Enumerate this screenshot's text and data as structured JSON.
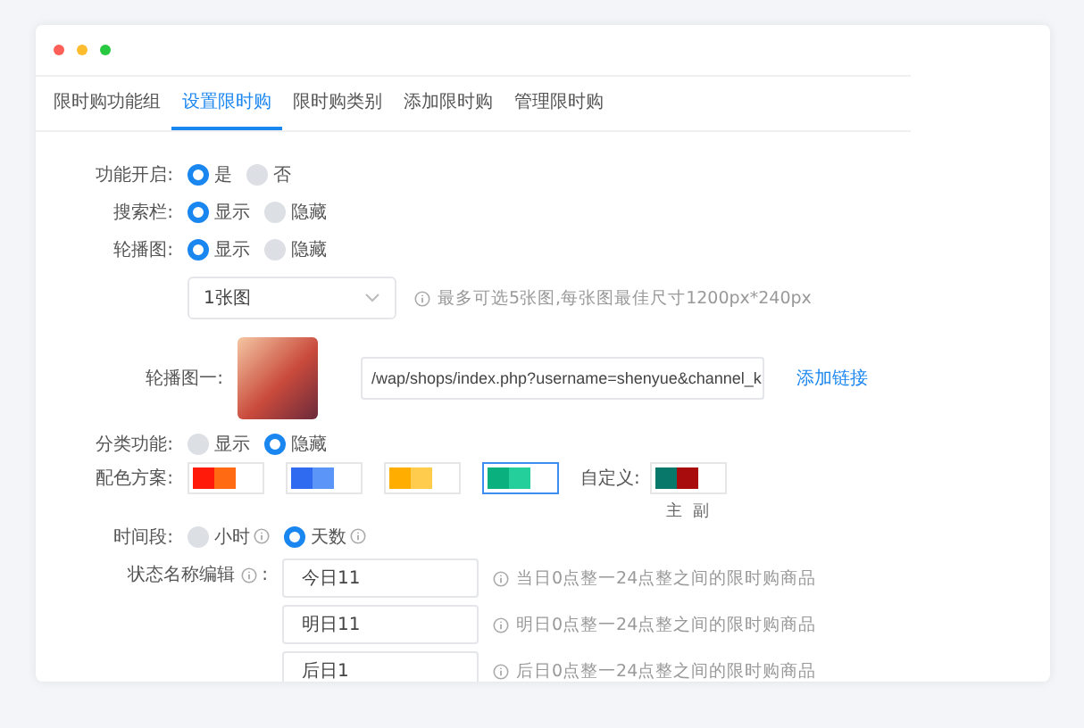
{
  "tabs": [
    {
      "label": "限时购功能组",
      "selected": false
    },
    {
      "label": "设置限时购",
      "selected": true
    },
    {
      "label": "限时购类别",
      "selected": false
    },
    {
      "label": "添加限时购",
      "selected": false
    },
    {
      "label": "管理限时购",
      "selected": false
    }
  ],
  "rows": [
    {
      "kind": "radio",
      "label": "功能开启:",
      "options": [
        {
          "label": "是",
          "selected": true,
          "info": false
        },
        {
          "label": "否",
          "selected": false,
          "info": false
        }
      ]
    },
    {
      "kind": "radio",
      "label": "搜索栏:",
      "options": [
        {
          "label": "显示",
          "selected": true,
          "info": false
        },
        {
          "label": "隐藏",
          "selected": false,
          "info": false
        }
      ]
    },
    {
      "kind": "radio",
      "label": "轮播图:",
      "options": [
        {
          "label": "显示",
          "selected": true,
          "info": false
        },
        {
          "label": "隐藏",
          "selected": false,
          "info": false
        }
      ]
    },
    {
      "kind": "select",
      "value": "1张图",
      "hint": "最多可选5张图,每张图最佳尺寸1200px*240px"
    },
    {
      "kind": "banner",
      "label": "轮播图一:",
      "link": "/wap/shops/index.php?username=shenyue&channel_k",
      "action": "添加链接"
    },
    {
      "kind": "radio",
      "label": "分类功能:",
      "options": [
        {
          "label": "显示",
          "selected": false,
          "info": false
        },
        {
          "label": "隐藏",
          "selected": true,
          "info": false
        }
      ]
    },
    {
      "kind": "colors",
      "label": "配色方案:",
      "schemes": [
        {
          "segments": [
            {
              "color": "#ff1a0a"
            },
            {
              "color": "#ff6a12"
            }
          ],
          "selected": false
        },
        {
          "segments": [
            {
              "color": "#2e6bf0"
            },
            {
              "color": "#5b95f7"
            }
          ],
          "selected": false
        },
        {
          "segments": [
            {
              "color": "#ffae00"
            },
            {
              "color": "#ffcc4d"
            }
          ],
          "selected": false
        },
        {
          "segments": [
            {
              "color": "#0bb07f"
            },
            {
              "color": "#25cf9c"
            }
          ],
          "selected": true
        }
      ],
      "custom_label": "自定义:",
      "custom": {
        "segments": [
          {
            "color": "#08786a"
          },
          {
            "color": "#a80c0c"
          }
        ],
        "captions": [
          "主",
          "副"
        ]
      }
    },
    {
      "kind": "radio",
      "label": "时间段:",
      "options": [
        {
          "label": "小时",
          "selected": false,
          "info": true
        },
        {
          "label": "天数",
          "selected": true,
          "info": true
        }
      ]
    },
    {
      "kind": "status",
      "label": "状态名称编辑",
      "suffix": ":",
      "items": [
        {
          "value": "今日11",
          "hint": "当日0点整一24点整之间的限时购商品"
        },
        {
          "value": "明日11",
          "hint": "明日0点整一24点整之间的限时购商品"
        },
        {
          "value": "后日1",
          "hint": "后日0点整一24点整之间的限时购商品"
        }
      ]
    }
  ]
}
